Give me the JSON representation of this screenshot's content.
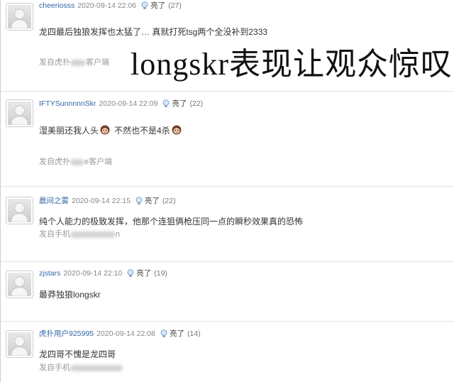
{
  "overlay_caption": "longskr表现让观众惊叹",
  "light_label": "亮了",
  "colors": {
    "username": "#3265a6",
    "timestamp": "#888888",
    "source_text": "#999999",
    "separator": "#e3e3e3"
  },
  "icons": {
    "avatar": "default-avatar-icon",
    "light": "lightbulb-icon",
    "emoji": "monkey-face-emoji-icon"
  },
  "comments": [
    {
      "user": "cheeriosss",
      "time": "2020-09-14 22:06",
      "likes": "(27)",
      "text": "龙四最后独狼发挥也太猛了… 真就打死tsg两个全没补到2333",
      "source_prefix": "发自虎扑",
      "source_suffix": "客户端"
    },
    {
      "user": "IFTYSunnnnnSkr",
      "time": "2020-09-14 22:09",
      "likes": "(22)",
      "text_parts": [
        "湿美丽还我人头",
        "不然也不是4杀"
      ],
      "source_prefix": "发自虎扑",
      "source_suffix": "e客户端"
    },
    {
      "user": "晨间之雾",
      "time": "2020-09-14 22:15",
      "likes": "(22)",
      "text": "纯个人能力的极致发挥，他那个连狙俩枪压同一点的瞬秒效果真的恐怖",
      "source_prefix": "发自手机",
      "source_suffix": "n"
    },
    {
      "user": "zjstars",
      "time": "2020-09-14 22:10",
      "likes": "(19)",
      "text": "最莽独狼longskr"
    },
    {
      "user": "虎扑用户925995",
      "time": "2020-09-14 22:08",
      "likes": "(14)",
      "text": "龙四哥不愧是龙四哥",
      "source_prefix": "发自手机"
    }
  ]
}
